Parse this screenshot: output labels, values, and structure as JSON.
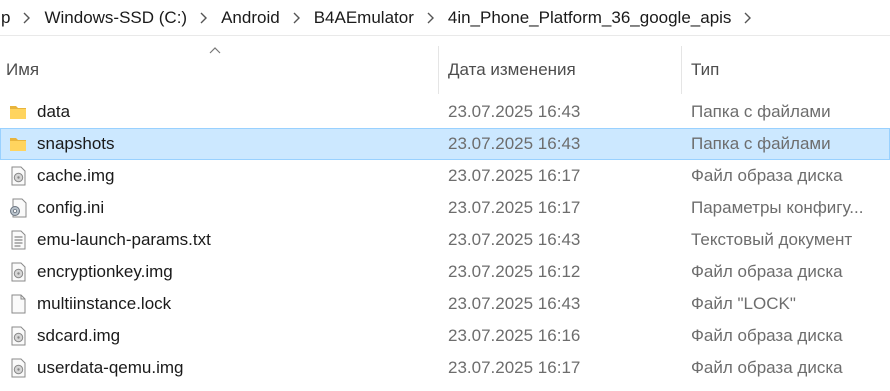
{
  "breadcrumb": {
    "items": [
      "p",
      "Windows-SSD (C:)",
      "Android",
      "B4AEmulator",
      "4in_Phone_Platform_36_google_apis"
    ]
  },
  "columns": {
    "name": "Имя",
    "date": "Дата изменения",
    "type": "Тип",
    "sort_indicator": "ascending"
  },
  "files": [
    {
      "name": "data",
      "date": "23.07.2025 16:43",
      "type": "Папка с файлами",
      "icon": "folder-icon",
      "selected": false
    },
    {
      "name": "snapshots",
      "date": "23.07.2025 16:43",
      "type": "Папка с файлами",
      "icon": "folder-icon",
      "selected": true
    },
    {
      "name": "cache.img",
      "date": "23.07.2025 16:17",
      "type": "Файл образа диска",
      "icon": "disk-image-icon",
      "selected": false
    },
    {
      "name": "config.ini",
      "date": "23.07.2025 16:17",
      "type": "Параметры конфигу...",
      "icon": "settings-file-icon",
      "selected": false
    },
    {
      "name": "emu-launch-params.txt",
      "date": "23.07.2025 16:43",
      "type": "Текстовый документ",
      "icon": "text-file-icon",
      "selected": false
    },
    {
      "name": "encryptionkey.img",
      "date": "23.07.2025 16:12",
      "type": "Файл образа диска",
      "icon": "disk-image-icon",
      "selected": false
    },
    {
      "name": "multiinstance.lock",
      "date": "23.07.2025 16:43",
      "type": "Файл \"LOCK\"",
      "icon": "blank-file-icon",
      "selected": false
    },
    {
      "name": "sdcard.img",
      "date": "23.07.2025 16:16",
      "type": "Файл образа диска",
      "icon": "disk-image-icon",
      "selected": false
    },
    {
      "name": "userdata-qemu.img",
      "date": "23.07.2025 16:17",
      "type": "Файл образа диска",
      "icon": "disk-image-icon",
      "selected": false
    }
  ],
  "colors": {
    "selection_bg": "#cce8ff",
    "selection_border": "#99d1ff",
    "folder": "#ffca28"
  }
}
